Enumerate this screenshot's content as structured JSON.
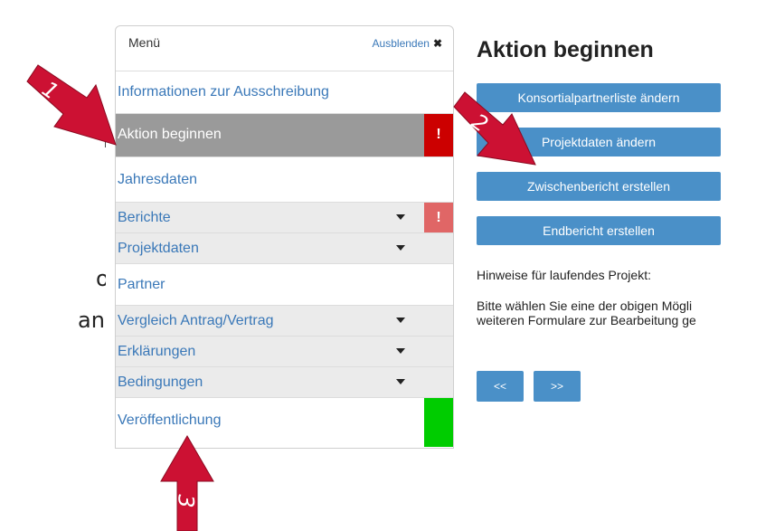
{
  "side_fragments": [
    "n",
    "ot",
    "an"
  ],
  "menu": {
    "title": "Menü",
    "hide_label": "Ausblenden",
    "items": [
      {
        "label": "Informationen zur Ausschreibung"
      },
      {
        "label": "Aktion beginnen",
        "flag": "!"
      },
      {
        "label": "Jahresdaten"
      },
      {
        "label": "Berichte",
        "flag": "!"
      },
      {
        "label": "Projektdaten"
      },
      {
        "label": "Partner"
      },
      {
        "label": "Vergleich Antrag/Vertrag"
      },
      {
        "label": "Erklärungen"
      },
      {
        "label": "Bedingungen"
      },
      {
        "label": "Veröffentlichung"
      }
    ]
  },
  "main": {
    "title": "Aktion beginnen",
    "buttons": [
      "Konsortialpartnerliste ändern",
      "Projektdaten ändern",
      "Zwischenbericht erstellen",
      "Endbericht erstellen"
    ],
    "hint_heading": "Hinweise für laufendes Projekt:",
    "hint_line1": "Bitte wählen Sie eine der obigen Mögli",
    "hint_line2": "weiteren Formulare zur Bearbeitung ge",
    "prev_label": "<<",
    "next_label": ">>"
  },
  "annotations": [
    "1",
    "2",
    "3"
  ],
  "colors": {
    "accent": "#4a90c8",
    "arrow": "#cc1133",
    "active_bg": "#9a9a9a",
    "alert": "#cc0000",
    "ok": "#00cc00"
  }
}
